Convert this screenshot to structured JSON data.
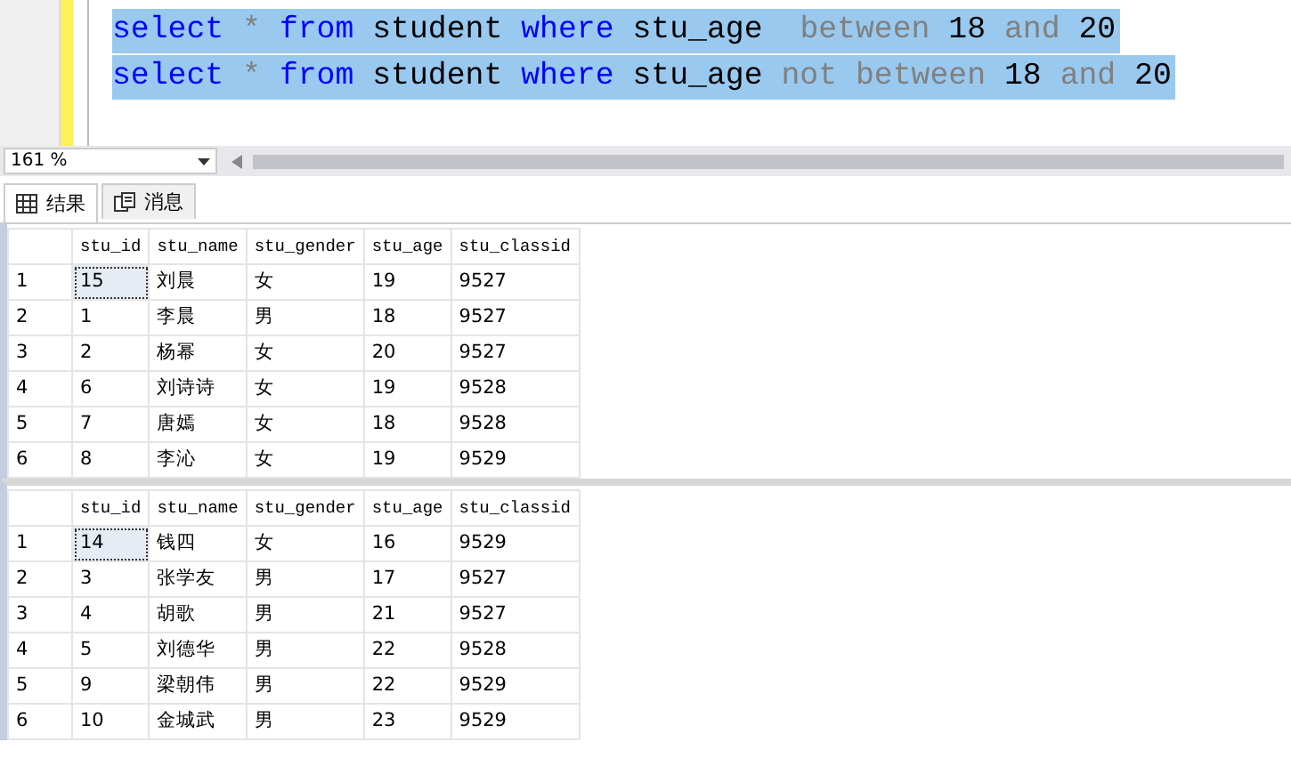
{
  "editor": {
    "lines": [
      [
        {
          "text": "select",
          "kind": "keyword"
        },
        {
          "text": " * ",
          "kind": "operator"
        },
        {
          "text": "from",
          "kind": "keyword"
        },
        {
          "text": " student ",
          "kind": "identifier"
        },
        {
          "text": "where",
          "kind": "keyword"
        },
        {
          "text": " stu_age  ",
          "kind": "identifier"
        },
        {
          "text": "between",
          "kind": "operator"
        },
        {
          "text": " 18 ",
          "kind": "identifier"
        },
        {
          "text": "and",
          "kind": "operator"
        },
        {
          "text": " 20",
          "kind": "identifier"
        }
      ],
      [
        {
          "text": "select",
          "kind": "keyword"
        },
        {
          "text": " * ",
          "kind": "operator"
        },
        {
          "text": "from",
          "kind": "keyword"
        },
        {
          "text": " student ",
          "kind": "identifier"
        },
        {
          "text": "where",
          "kind": "keyword"
        },
        {
          "text": " stu_age ",
          "kind": "identifier"
        },
        {
          "text": "not between",
          "kind": "operator"
        },
        {
          "text": " 18 ",
          "kind": "identifier"
        },
        {
          "text": "and",
          "kind": "operator"
        },
        {
          "text": " 20",
          "kind": "identifier"
        }
      ]
    ],
    "zoom": "161 %"
  },
  "tabs": [
    {
      "label": "结果",
      "selected": true,
      "kind": "grid"
    },
    {
      "label": "消息",
      "selected": false,
      "kind": "messages"
    }
  ],
  "grids": [
    {
      "columns": [
        "stu_id",
        "stu_name",
        "stu_gender",
        "stu_age",
        "stu_classid"
      ],
      "rows": [
        {
          "number": "1",
          "cells": [
            {
              "text": "15",
              "selected": true
            },
            {
              "text": "刘晨",
              "selected": false
            },
            {
              "text": "女",
              "selected": false
            },
            {
              "text": "19",
              "selected": false
            },
            {
              "text": "9527",
              "selected": false
            }
          ]
        },
        {
          "number": "2",
          "cells": [
            {
              "text": "1",
              "selected": false
            },
            {
              "text": "李晨",
              "selected": false
            },
            {
              "text": "男",
              "selected": false
            },
            {
              "text": "18",
              "selected": false
            },
            {
              "text": "9527",
              "selected": false
            }
          ]
        },
        {
          "number": "3",
          "cells": [
            {
              "text": "2",
              "selected": false
            },
            {
              "text": "杨幂",
              "selected": false
            },
            {
              "text": "女",
              "selected": false
            },
            {
              "text": "20",
              "selected": false
            },
            {
              "text": "9527",
              "selected": false
            }
          ]
        },
        {
          "number": "4",
          "cells": [
            {
              "text": "6",
              "selected": false
            },
            {
              "text": "刘诗诗",
              "selected": false
            },
            {
              "text": "女",
              "selected": false
            },
            {
              "text": "19",
              "selected": false
            },
            {
              "text": "9528",
              "selected": false
            }
          ]
        },
        {
          "number": "5",
          "cells": [
            {
              "text": "7",
              "selected": false
            },
            {
              "text": "唐嫣",
              "selected": false
            },
            {
              "text": "女",
              "selected": false
            },
            {
              "text": "18",
              "selected": false
            },
            {
              "text": "9528",
              "selected": false
            }
          ]
        },
        {
          "number": "6",
          "cells": [
            {
              "text": "8",
              "selected": false
            },
            {
              "text": "李沁",
              "selected": false
            },
            {
              "text": "女",
              "selected": false
            },
            {
              "text": "19",
              "selected": false
            },
            {
              "text": "9529",
              "selected": false
            }
          ]
        }
      ]
    },
    {
      "columns": [
        "stu_id",
        "stu_name",
        "stu_gender",
        "stu_age",
        "stu_classid"
      ],
      "rows": [
        {
          "number": "1",
          "cells": [
            {
              "text": "14",
              "selected": true
            },
            {
              "text": "钱四",
              "selected": false
            },
            {
              "text": "女",
              "selected": false
            },
            {
              "text": "16",
              "selected": false
            },
            {
              "text": "9529",
              "selected": false
            }
          ]
        },
        {
          "number": "2",
          "cells": [
            {
              "text": "3",
              "selected": false
            },
            {
              "text": "张学友",
              "selected": false
            },
            {
              "text": "男",
              "selected": false
            },
            {
              "text": "17",
              "selected": false
            },
            {
              "text": "9527",
              "selected": false
            }
          ]
        },
        {
          "number": "3",
          "cells": [
            {
              "text": "4",
              "selected": false
            },
            {
              "text": "胡歌",
              "selected": false
            },
            {
              "text": "男",
              "selected": false
            },
            {
              "text": "21",
              "selected": false
            },
            {
              "text": "9527",
              "selected": false
            }
          ]
        },
        {
          "number": "4",
          "cells": [
            {
              "text": "5",
              "selected": false
            },
            {
              "text": "刘德华",
              "selected": false
            },
            {
              "text": "男",
              "selected": false
            },
            {
              "text": "22",
              "selected": false
            },
            {
              "text": "9528",
              "selected": false
            }
          ]
        },
        {
          "number": "5",
          "cells": [
            {
              "text": "9",
              "selected": false
            },
            {
              "text": "梁朝伟",
              "selected": false
            },
            {
              "text": "男",
              "selected": false
            },
            {
              "text": "22",
              "selected": false
            },
            {
              "text": "9529",
              "selected": false
            }
          ]
        },
        {
          "number": "6",
          "cells": [
            {
              "text": "10",
              "selected": false
            },
            {
              "text": "金城武",
              "selected": false
            },
            {
              "text": "男",
              "selected": false
            },
            {
              "text": "23",
              "selected": false
            },
            {
              "text": "9529",
              "selected": false
            }
          ]
        }
      ]
    }
  ]
}
